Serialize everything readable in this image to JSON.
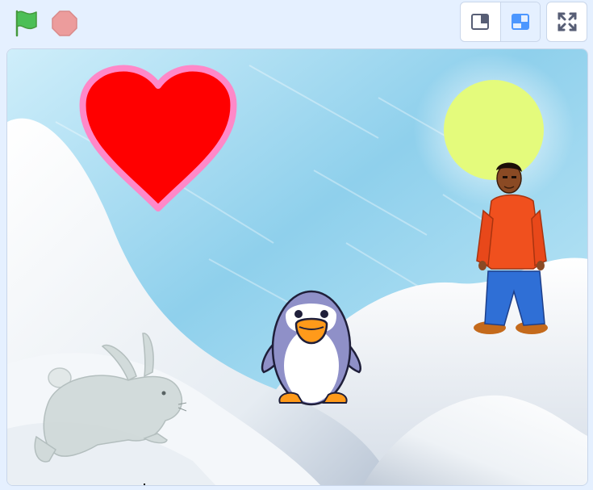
{
  "toolbar": {
    "green_flag": {
      "icon": "green-flag-icon",
      "color": "#4cbf56"
    },
    "stop": {
      "icon": "stop-icon",
      "color": "#ec9c9c"
    },
    "layout_modes": [
      {
        "icon": "small-stage-icon",
        "active": false
      },
      {
        "icon": "normal-stage-icon",
        "active": true
      }
    ],
    "fullscreen": {
      "icon": "fullscreen-icon"
    }
  },
  "stage": {
    "backdrop": "winter",
    "sprites": [
      "heart",
      "sun",
      "boy",
      "penguin",
      "hare"
    ],
    "colors": {
      "sky": "#9fd7ef",
      "snow": "#f2f5f8",
      "heart": "#ff0000",
      "heart_outline": "#ff88c8",
      "sun": "#e4fb7c",
      "jacket": "#f0501e",
      "jeans": "#2f6fd6",
      "penguin": "#8f90c8",
      "beak": "#ff9a1a",
      "hare": "#cdd7d6"
    }
  }
}
